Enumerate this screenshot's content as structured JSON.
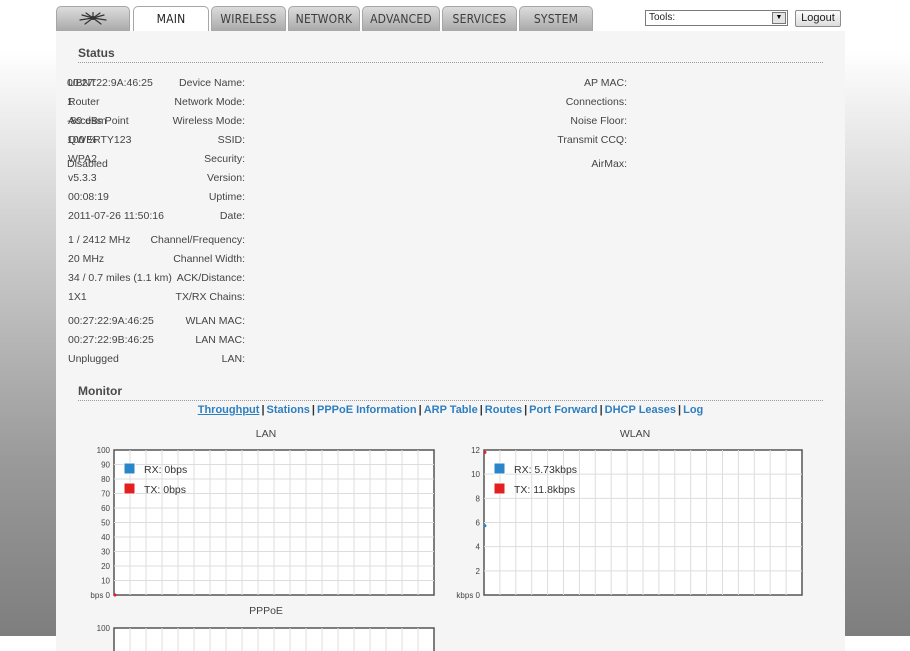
{
  "tabs": [
    {
      "label": "",
      "icon": "ubiquiti-logo-icon"
    },
    {
      "label": "MAIN"
    },
    {
      "label": "WIRELESS"
    },
    {
      "label": "NETWORK"
    },
    {
      "label": "ADVANCED"
    },
    {
      "label": "SERVICES"
    },
    {
      "label": "SYSTEM"
    }
  ],
  "active_tab": "MAIN",
  "tools": {
    "label": "Tools:"
  },
  "logout_label": "Logout",
  "status": {
    "title": "Status",
    "left": [
      {
        "label": "Device Name:",
        "value": "UBNT"
      },
      {
        "label": "Network Mode:",
        "value": "Router"
      },
      {
        "label": "Wireless Mode:",
        "value": "Access Point"
      },
      {
        "label": "SSID:",
        "value": "QWERTY123"
      },
      {
        "label": "Security:",
        "value": "WPA2"
      },
      {
        "label": "Version:",
        "value": "v5.3.3"
      },
      {
        "label": "Uptime:",
        "value": "00:08:19"
      },
      {
        "label": "Date:",
        "value": "2011-07-26 11:50:16"
      },
      {
        "label": "Channel/Frequency:",
        "value": "1 / 2412 MHz"
      },
      {
        "label": "Channel Width:",
        "value": "20 MHz"
      },
      {
        "label": "ACK/Distance:",
        "value": "34 / 0.7 miles (1.1 km)"
      },
      {
        "label": "TX/RX Chains:",
        "value": "1X1"
      },
      {
        "label": "WLAN MAC:",
        "value": "00:27:22:9A:46:25"
      },
      {
        "label": "LAN MAC:",
        "value": "00:27:22:9B:46:25"
      },
      {
        "label": "LAN:",
        "value": "Unplugged"
      }
    ],
    "right": [
      {
        "label": "AP MAC:",
        "value": "00:27:22:9A:46:25"
      },
      {
        "label": "Connections:",
        "value": "1"
      },
      {
        "label": "Noise Floor:",
        "value": "-89 dBm"
      },
      {
        "label": "Transmit CCQ:",
        "value": "100 %"
      },
      {
        "label": "AirMax:",
        "value": "Disabled"
      }
    ]
  },
  "monitor": {
    "title": "Monitor",
    "links": [
      "Throughput",
      "Stations",
      "PPPoE Information",
      "ARP Table",
      "Routes",
      "Port Forward",
      "DHCP Leases",
      "Log"
    ],
    "active_link": "Throughput"
  },
  "colors": {
    "rx": "#2a86c8",
    "tx": "#e41f1f",
    "link": "#2e7fc0"
  },
  "chart_data": [
    {
      "type": "line",
      "title": "LAN",
      "ylabel": "bps",
      "ylim": [
        0,
        100
      ],
      "yticks": [
        0,
        10,
        20,
        30,
        40,
        50,
        60,
        70,
        80,
        90,
        100
      ],
      "series": [
        {
          "name": "RX: 0bps",
          "values": [
            0
          ]
        },
        {
          "name": "TX: 0bps",
          "values": [
            0
          ]
        }
      ]
    },
    {
      "type": "line",
      "title": "WLAN",
      "ylabel": "kbps",
      "ylim": [
        0,
        12
      ],
      "yticks": [
        0,
        2,
        4,
        6,
        8,
        10,
        12
      ],
      "series": [
        {
          "name": "RX: 5.73kbps",
          "values": [
            5.73
          ]
        },
        {
          "name": "TX: 11.8kbps",
          "values": [
            11.8
          ]
        }
      ]
    },
    {
      "type": "line",
      "title": "PPPoE",
      "ylabel": "",
      "ylim": [
        0,
        100
      ],
      "yticks": [
        100
      ],
      "series": []
    }
  ]
}
